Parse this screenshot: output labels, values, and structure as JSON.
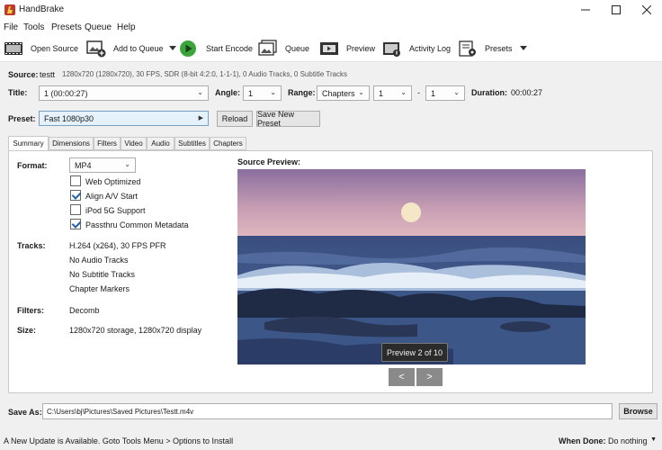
{
  "app": {
    "title": "HandBrake"
  },
  "menu": {
    "file": "File",
    "tools": "Tools",
    "presets": "Presets",
    "queue": "Queue",
    "help": "Help"
  },
  "toolbar": {
    "open_source": "Open Source",
    "add_to_queue": "Add to Queue",
    "start_encode": "Start Encode",
    "queue": "Queue",
    "preview": "Preview",
    "activity_log": "Activity Log",
    "presets": "Presets"
  },
  "source": {
    "label": "Source:",
    "name": "testt",
    "info": "1280x720 (1280x720), 30 FPS, SDR (8-bit 4:2:0, 1-1-1), 0 Audio Tracks, 0 Subtitle Tracks"
  },
  "title_row": {
    "title_label": "Title:",
    "title_value": "1 (00:00:27)",
    "angle_label": "Angle:",
    "angle_value": "1",
    "range_label": "Range:",
    "range_value": "Chapters",
    "range_start": "1",
    "range_dash": "-",
    "range_end": "1",
    "duration_label": "Duration:",
    "duration_value": "00:00:27"
  },
  "preset_row": {
    "label": "Preset:",
    "value": "Fast 1080p30",
    "reload": "Reload",
    "save_new": "Save New Preset"
  },
  "tabs": [
    "Summary",
    "Dimensions",
    "Filters",
    "Video",
    "Audio",
    "Subtitles",
    "Chapters"
  ],
  "summary": {
    "format_label": "Format:",
    "format_value": "MP4",
    "options": [
      {
        "label": "Web Optimized",
        "checked": false
      },
      {
        "label": "Align A/V Start",
        "checked": true
      },
      {
        "label": "iPod 5G Support",
        "checked": false
      },
      {
        "label": "Passthru Common Metadata",
        "checked": true
      }
    ],
    "tracks_label": "Tracks:",
    "tracks": [
      "H.264 (x264), 30 FPS PFR",
      "No Audio Tracks",
      "No Subtitle Tracks",
      "Chapter Markers"
    ],
    "filters_label": "Filters:",
    "filters_value": "Decomb",
    "size_label": "Size:",
    "size_value": "1280x720 storage, 1280x720 display",
    "preview_label": "Source Preview:",
    "preview_counter": "Preview 2 of 10",
    "prev_glyph": "<",
    "next_glyph": ">"
  },
  "save_as": {
    "label": "Save As:",
    "path": "C:\\Users\\bj\\Pictures\\Saved Pictures\\Testt.m4v",
    "browse": "Browse"
  },
  "status": {
    "message": "A New Update is Available. Goto Tools Menu > Options to Install",
    "when_done_label": "When Done:",
    "when_done_value": "Do nothing"
  },
  "colors": {
    "accent": "#1f5fa8",
    "play_green": "#3aa53a"
  }
}
